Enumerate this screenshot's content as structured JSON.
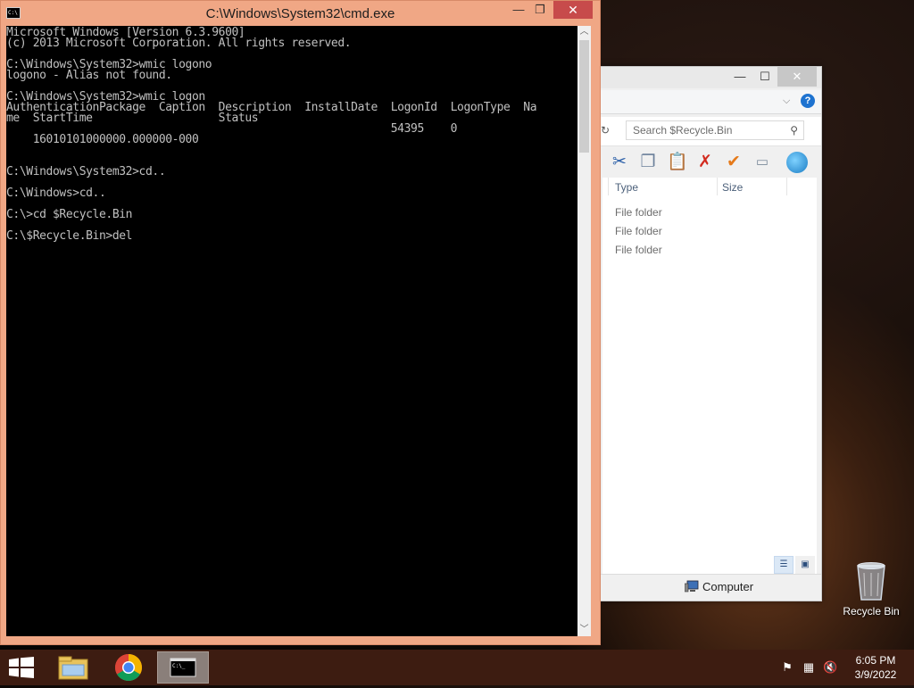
{
  "cmd": {
    "title": "C:\\Windows\\System32\\cmd.exe",
    "icon_label": "C:\\",
    "buttons": {
      "minimize": "—",
      "maximize": "❐",
      "close": "✕"
    },
    "lines": [
      "Microsoft Windows [Version 6.3.9600]",
      "(c) 2013 Microsoft Corporation. All rights reserved.",
      "",
      "C:\\Windows\\System32>wmic logono",
      "logono - Alias not found.",
      "",
      "C:\\Windows\\System32>wmic logon",
      "AuthenticationPackage  Caption  Description  InstallDate  LogonId  LogonType  Na",
      "me  StartTime                   Status",
      "                                                          54395    0",
      "    16010101000000.000000-000",
      "",
      "",
      "C:\\Windows\\System32>cd..",
      "",
      "C:\\Windows>cd..",
      "",
      "C:\\>cd $Recycle.Bin",
      "",
      "C:\\$Recycle.Bin>del"
    ]
  },
  "explorer": {
    "buttons": {
      "minimize": "—",
      "maximize": "☐",
      "close": "✕"
    },
    "search_placeholder": "Search $Recycle.Bin",
    "columns": {
      "type": "Type",
      "size": "Size"
    },
    "rows": [
      "File folder",
      "File folder",
      "File folder"
    ],
    "status": "Computer",
    "colors": {
      "accent_blue": "#1e73d0"
    }
  },
  "desktop": {
    "recycle_bin_label": "Recycle Bin"
  },
  "taskbar": {
    "apps": [
      "file-explorer-icon",
      "chrome-icon",
      "cmd-icon"
    ],
    "time": "6:05 PM",
    "date": "3/9/2022"
  }
}
